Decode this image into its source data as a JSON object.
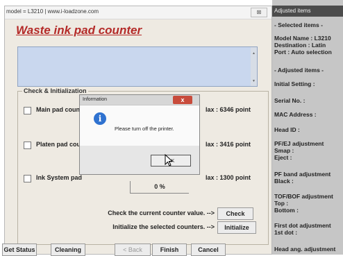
{
  "window": {
    "title_text": "model = L3210 | www.i-loadzone.com",
    "close_glyph": "⊠",
    "heading": "Waste ink pad counter"
  },
  "group": {
    "title": "Check & Initialization",
    "rows": [
      {
        "label": "Main pad coun",
        "max": "lax : 6346 point"
      },
      {
        "label": "Platen pad cou",
        "max": "lax : 3416 point"
      },
      {
        "label": "Ink System pad",
        "max": "lax : 1300 point"
      }
    ],
    "percent_value": "0",
    "percent_unit": "%"
  },
  "actions": {
    "check_text": "Check the current counter value. -->",
    "check_button": "Check",
    "init_text": "Initialize the selected counters. -->",
    "init_button": "Initialize"
  },
  "footer": {
    "get_status": "Get Status",
    "cleaning": "Cleaning",
    "back": "< Back",
    "finish": "Finish",
    "cancel": "Cancel"
  },
  "dialog": {
    "title": "Information",
    "close": "x",
    "message": "Please turn off the printer.",
    "ok": "OK",
    "icon": "info-icon"
  },
  "right_panel": {
    "header": "Adjusted items",
    "items": [
      "- Selected items -",
      "Model Name : L3210",
      "Destination : Latin",
      "Port : Auto selection",
      "- Adjusted items -",
      "Initial Setting :",
      "Serial No. :",
      "MAC Address :",
      "Head ID :",
      "PF/EJ adjustment",
      "Smap :",
      "Eject :",
      "PF band adjustment",
      "Black :",
      "TOF/BOF adjustment",
      "Top :",
      "Bottom :",
      "First dot adjustment",
      "1st dot :",
      "Head ang. adjustment"
    ]
  },
  "colors": {
    "heading": "#b42a28",
    "textbox": "#c9d7ee",
    "panel": "#eeeae2",
    "dialog_close": "#c84b3b",
    "info_icon": "#2f72d0"
  }
}
